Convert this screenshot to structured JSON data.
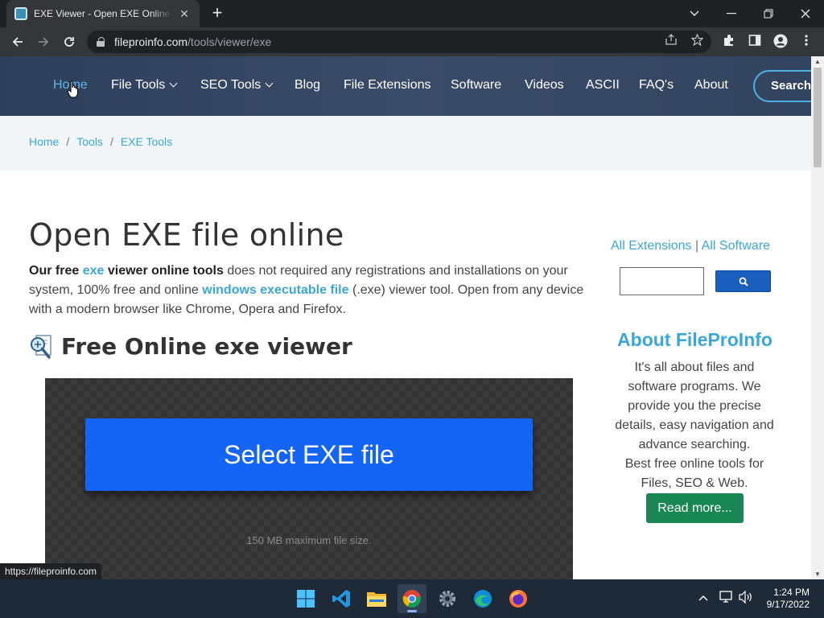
{
  "browser": {
    "tab_title": "EXE Viewer - Open EXE Online & Free",
    "tab_close": "✕",
    "new_tab": "+",
    "url_host": "fileproinfo.com",
    "url_path": "/tools/viewer/exe",
    "window_controls": {
      "tab_search": "⌵",
      "minimize": "—",
      "restore": "❐",
      "close": "✕"
    }
  },
  "site_nav": {
    "items": [
      {
        "label": "Home"
      },
      {
        "label": "File Tools"
      },
      {
        "label": "SEO Tools"
      },
      {
        "label": "Blog"
      },
      {
        "label": "File Extensions"
      },
      {
        "label": "Software"
      },
      {
        "label": "Videos"
      },
      {
        "label": "ASCII"
      },
      {
        "label": "FAQ's"
      },
      {
        "label": "About"
      }
    ],
    "search_label": "Search"
  },
  "breadcrumb": {
    "items": [
      "Home",
      "Tools",
      "EXE Tools"
    ],
    "separator": "/"
  },
  "main": {
    "title": "Open EXE file online",
    "intro": {
      "p1_bold": "Our free",
      "p1_link": "exe",
      "p1_bold2": "viewer online tools",
      "p1_text": "does not required any registrations and installations on your system, 100% free and online",
      "p1_link2": "windows executable file",
      "p1_text2": "(.exe) viewer tool. Open from any device with a modern browser like Chrome, Opera and Firefox."
    },
    "section_title": "Free Online exe viewer",
    "upload": {
      "button_label": "Select EXE file",
      "max_size": "150 MB maximum file size."
    }
  },
  "sidebar": {
    "link_extensions": "All Extensions",
    "link_divider": "|",
    "link_software": "All Software",
    "about_title": "About FileProInfo",
    "about_text": "It's all about files and software programs. We provide you the precise details, easy navigation and advance searching.",
    "about_text2": "Best free online tools for Files, SEO & Web.",
    "read_more": "Read more..."
  },
  "status_bar_url": "https://fileproinfo.com",
  "taskbar": {
    "apps": [
      "windows-start",
      "vscode",
      "file-explorer",
      "chrome",
      "settings",
      "edge",
      "firefox"
    ],
    "tray_chevron": "︿",
    "time": "1:24 PM",
    "date": "9/17/2022"
  },
  "colors": {
    "nav_bg": "#3a4b68",
    "link_blue": "#3ba6d8",
    "select_button": "#1464f6",
    "read_more": "#198754"
  }
}
